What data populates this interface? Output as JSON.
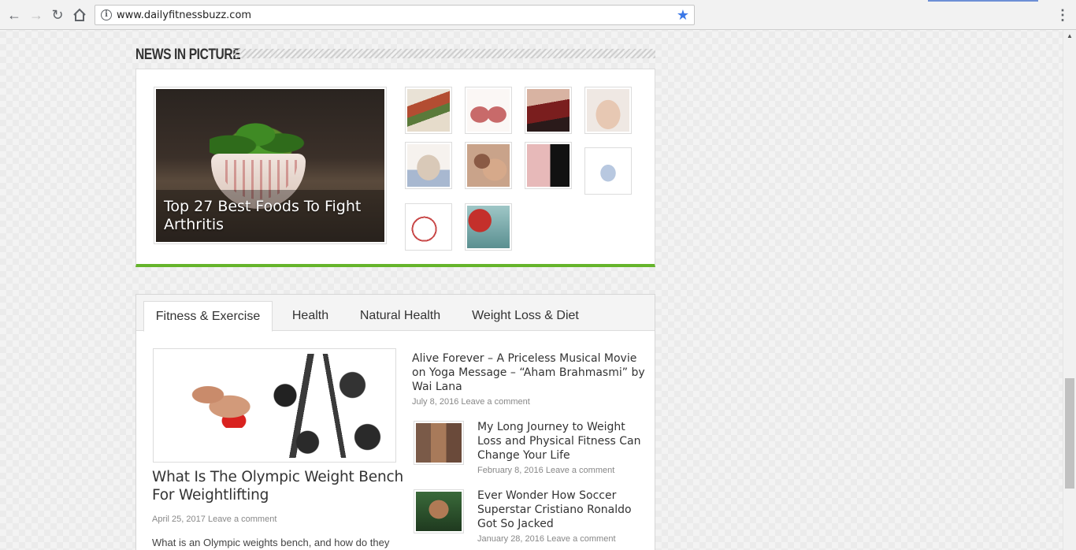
{
  "browser": {
    "url": "www.dailyfitnessbuzz.com"
  },
  "news_in_picture": {
    "title": "News in Picture",
    "featured_caption": "Top 27 Best Foods To Fight Arthritis",
    "thumbnails": [
      {
        "name": "thumb-herbs"
      },
      {
        "name": "thumb-kidneys"
      },
      {
        "name": "thumb-massage"
      },
      {
        "name": "thumb-stomach"
      },
      {
        "name": "thumb-back-brace"
      },
      {
        "name": "thumb-couple"
      },
      {
        "name": "thumb-dress"
      },
      {
        "name": "thumb-device"
      },
      {
        "name": "thumb-diagram"
      },
      {
        "name": "thumb-santa"
      }
    ]
  },
  "tabs": {
    "items": [
      {
        "label": "Fitness & Exercise",
        "active": true
      },
      {
        "label": "Health",
        "active": false
      },
      {
        "label": "Natural Health",
        "active": false
      },
      {
        "label": "Weight Loss & Diet",
        "active": false
      }
    ]
  },
  "main_post": {
    "title": "What Is The Olympic Weight Bench For Weightlifting",
    "date": "April 25, 2017",
    "comment_link": "Leave a comment",
    "excerpt": "What is an Olympic weights bench, and how do they"
  },
  "side_posts": [
    {
      "title": "Alive Forever – A Priceless Musical Movie on Yoga Message – “Aham Brahmasmi” by Wai Lana",
      "date": "July 8, 2016",
      "comment_link": "Leave a comment"
    },
    {
      "title": "My Long Journey to Weight Loss and Physical Fitness Can Change Your Life",
      "date": "February 8, 2016",
      "comment_link": "Leave a comment"
    },
    {
      "title": "Ever Wonder How Soccer Superstar Cristiano Ronaldo Got So Jacked",
      "date": "January 28, 2016",
      "comment_link": "Leave a comment"
    }
  ],
  "colors": {
    "accent_green": "#65b42b",
    "bookmark_star": "#3b78e7"
  }
}
